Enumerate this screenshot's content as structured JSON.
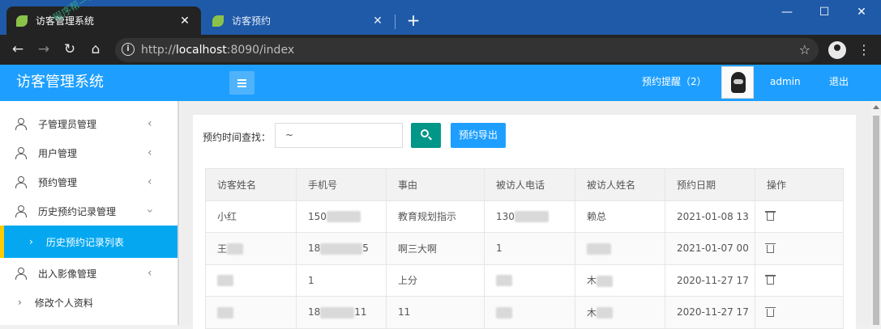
{
  "browser": {
    "tabs": [
      {
        "title": "访客管理系统",
        "active": true
      },
      {
        "title": "访客预约",
        "active": false
      }
    ],
    "url_prefix": "http://",
    "url_host": "localhost",
    "url_rest": ":8090/index"
  },
  "header": {
    "logo": "访客管理系统",
    "remind": "预约提醒（2）",
    "username": "admin",
    "logout": "退出"
  },
  "watermark": "程序帮—1…",
  "sidebar": {
    "items": [
      {
        "label": "子管理员管理"
      },
      {
        "label": "用户管理"
      },
      {
        "label": "预约管理"
      },
      {
        "label": "历史预约记录管理"
      },
      {
        "label": "历史预约记录列表"
      },
      {
        "label": "出入影像管理"
      },
      {
        "label": "修改个人资料"
      }
    ]
  },
  "search": {
    "label": "预约时间查找：",
    "date_value": "~",
    "export_label": "预约导出"
  },
  "table": {
    "headers": [
      "访客姓名",
      "手机号",
      "事由",
      "被访人电话",
      "被访人姓名",
      "预约日期",
      "操作"
    ],
    "rows": [
      {
        "name": "小红",
        "phone": "150",
        "reason": "教育规划指示",
        "host_phone": "130",
        "host_name": "赖总",
        "date": "2021-01-08 13"
      },
      {
        "name": "王",
        "phone": "18",
        "phone_tail": "5",
        "reason": "啊三大啊",
        "host_phone": "1",
        "host_name": "",
        "date": "2021-01-07 00"
      },
      {
        "name": "",
        "phone": "1",
        "reason": "上分",
        "host_phone": "",
        "host_name": "木",
        "date": "2020-11-27 17"
      },
      {
        "name": "",
        "phone": "18",
        "phone_tail": "11",
        "reason": "11",
        "host_phone": "",
        "host_name": "木",
        "date": "2020-11-27 17"
      }
    ]
  },
  "colors": {
    "header_bg": "#1e9fff",
    "active_menu": "#05a8f0",
    "search_btn": "#009688",
    "export_btn": "#1e9fff"
  }
}
